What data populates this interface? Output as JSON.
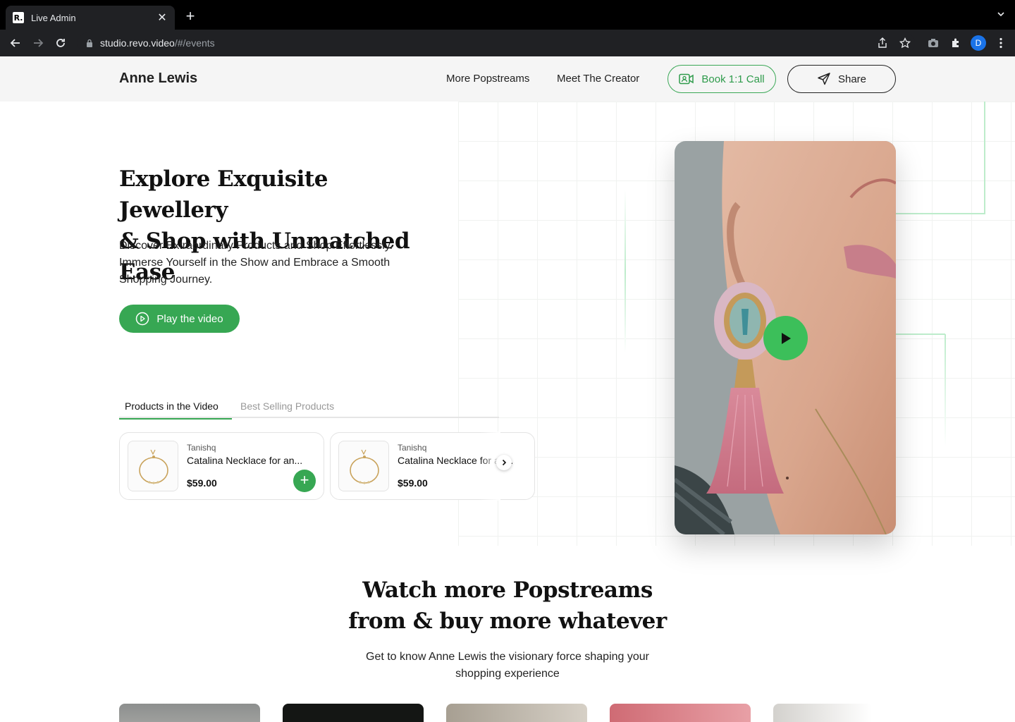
{
  "browser": {
    "tab_title": "Live Admin",
    "favicon_text": "R.",
    "url_host": "studio.revo.video",
    "url_path": "/#/events",
    "profile_initial": "D"
  },
  "header": {
    "brand": "Anne Lewis",
    "nav": [
      "More Popstreams",
      "Meet The Creator"
    ],
    "book_label": "Book 1:1 Call",
    "share_label": "Share"
  },
  "hero": {
    "title_line1": "Explore Exquisite Jewellery",
    "title_line2": "& Shop with Unmatched Ease",
    "subtitle": "Discover Extraordinary Products and Shop Effortlessly. Immerse Yourself in the Show and Embrace a Smooth Shopping Journey.",
    "play_label": "Play the video"
  },
  "products": {
    "tabs": [
      "Products in the Video",
      "Best Selling Products"
    ],
    "items": [
      {
        "brand": "Tanishq",
        "name": "Catalina Necklace for an...",
        "price": "$59.00"
      },
      {
        "brand": "Tanishq",
        "name": "Catalina Necklace for an...",
        "price": "$59.00"
      }
    ]
  },
  "section2": {
    "title_line1": "Watch more Popstreams",
    "title_line2": "from & buy more whatever",
    "subtitle": "Get to know Anne Lewis the visionary force shaping your shopping experience"
  },
  "colors": {
    "accent_green": "#37a753",
    "chrome_dark": "#202124"
  },
  "icons": [
    "back-arrow-icon",
    "forward-arrow-icon",
    "reload-icon",
    "lock-icon",
    "share-icon",
    "star-icon",
    "camera-icon",
    "extension-icon",
    "kebab-menu-icon",
    "video-camera-icon",
    "send-icon",
    "play-circle-icon",
    "plus-icon",
    "chevron-right-icon",
    "play-icon"
  ]
}
